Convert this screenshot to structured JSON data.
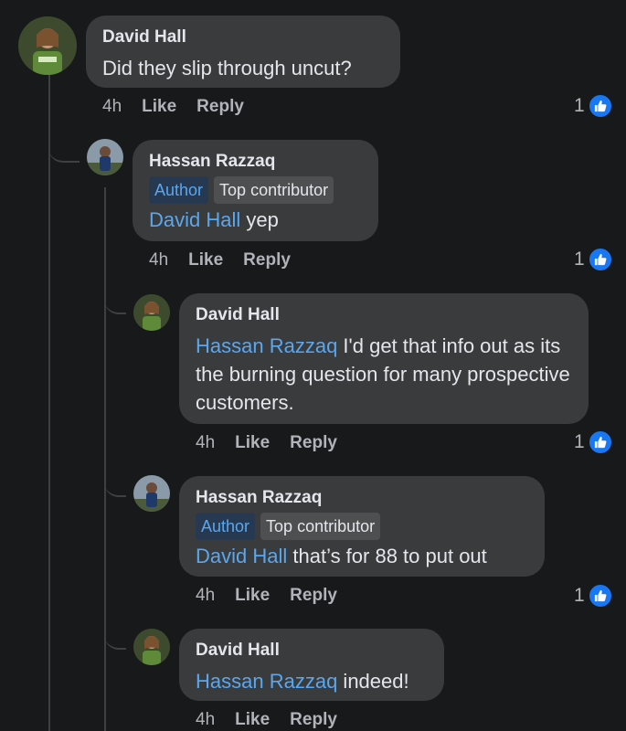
{
  "comments": [
    {
      "author": "David Hall",
      "mention": "",
      "text": "Did they slip through uncut?",
      "badges": [],
      "time": "4h",
      "like": "Like",
      "reply": "Reply",
      "reactions": "1"
    },
    {
      "author": "Hassan Razzaq",
      "mention": "David Hall",
      "text": " yep",
      "badges": [
        "Author",
        "Top contributor"
      ],
      "time": "4h",
      "like": "Like",
      "reply": "Reply",
      "reactions": "1"
    },
    {
      "author": "David Hall",
      "mention": "Hassan Razzaq",
      "text": " I'd get that info out as its the burning question for many prospective customers.",
      "badges": [],
      "time": "4h",
      "like": "Like",
      "reply": "Reply",
      "reactions": "1"
    },
    {
      "author": "Hassan Razzaq",
      "mention": "David Hall",
      "text": " that’s for 88 to put out",
      "badges": [
        "Author",
        "Top contributor"
      ],
      "time": "4h",
      "like": "Like",
      "reply": "Reply",
      "reactions": "1"
    },
    {
      "author": "David Hall",
      "mention": "Hassan Razzaq",
      "text": " indeed!",
      "badges": [],
      "time": "4h",
      "like": "Like",
      "reply": "Reply",
      "reactions": ""
    }
  ],
  "colors": {
    "background": "#18191a",
    "bubble": "#3a3b3c",
    "mention": "#5aa7f0",
    "like_blue": "#1877f2"
  },
  "icons": {
    "reaction": "thumbs-up-icon"
  }
}
